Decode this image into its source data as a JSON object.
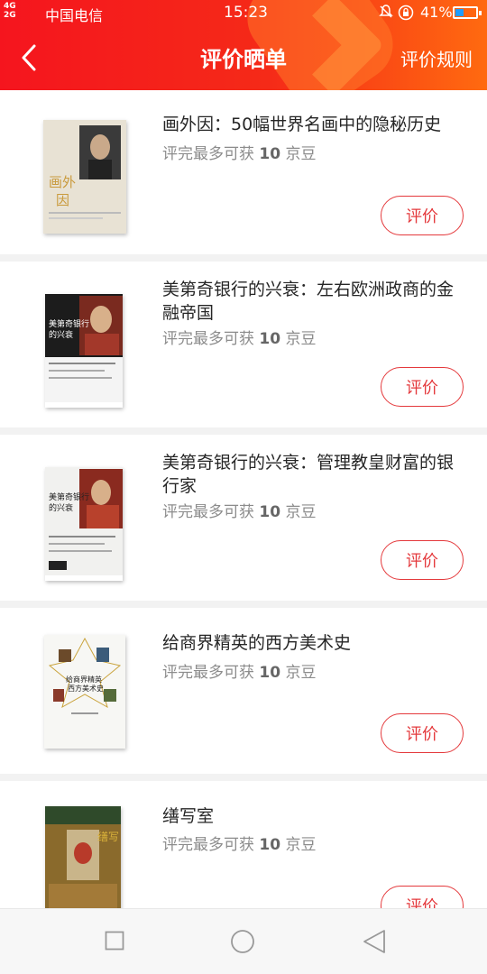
{
  "status_bar": {
    "signal": "4G",
    "signal2": "2G",
    "carrier": "中国电信",
    "time": "15:23",
    "battery": "41%",
    "battery_level": 0.41
  },
  "header": {
    "back_icon": "chevron-left-icon",
    "title": "评价晒单",
    "rules_link": "评价规则"
  },
  "items": [
    {
      "title": "画外因：50幅世界名画中的隐秘历史",
      "reward_prefix": "评完最多可获",
      "reward_amount": "10",
      "reward_unit": "京豆",
      "button": "评价",
      "cover": {
        "bg": "#e8e2d4",
        "cover_text": "画外因",
        "accent": "#c99a3c"
      }
    },
    {
      "title": "美第奇银行的兴衰：左右欧洲政商的金融帝国",
      "reward_prefix": "评完最多可获",
      "reward_amount": "10",
      "reward_unit": "京豆",
      "button": "评价",
      "cover": {
        "bg": "#1c1c1c",
        "cover_text": "美第奇银行的兴衰",
        "accent": "#b83a2a"
      }
    },
    {
      "title": "美第奇银行的兴衰：管理教皇财富的银行家",
      "reward_prefix": "评完最多可获",
      "reward_amount": "10",
      "reward_unit": "京豆",
      "button": "评价",
      "cover": {
        "bg": "#f1f1ef",
        "cover_text": "美第奇银行的兴衰",
        "accent": "#b83a2a"
      }
    },
    {
      "title": "给商界精英的西方美术史",
      "reward_prefix": "评完最多可获",
      "reward_amount": "10",
      "reward_unit": "京豆",
      "button": "评价",
      "cover": {
        "bg": "#f7f7f4",
        "cover_text": "给商界精英的西方美术史",
        "accent": "#c9a23a"
      }
    },
    {
      "title": "缮写室",
      "reward_prefix": "评完最多可获",
      "reward_amount": "10",
      "reward_unit": "京豆",
      "button": "评价",
      "cover": {
        "bg": "#8a6a2c",
        "cover_text": "缮写室",
        "accent": "#d9b13a"
      }
    }
  ],
  "nav_bar": {
    "recent_icon": "square-icon",
    "home_icon": "circle-icon",
    "back_icon": "triangle-back-icon"
  }
}
